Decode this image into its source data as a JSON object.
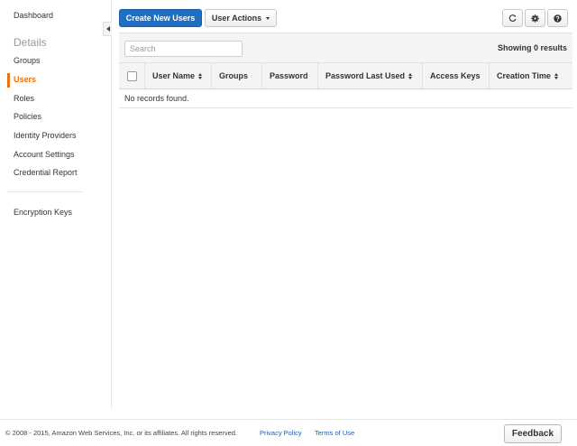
{
  "sidebar": {
    "dashboard": "Dashboard",
    "section_heading": "Details",
    "items": [
      {
        "label": "Groups"
      },
      {
        "label": "Users"
      },
      {
        "label": "Roles"
      },
      {
        "label": "Policies"
      },
      {
        "label": "Identity Providers"
      },
      {
        "label": "Account Settings"
      },
      {
        "label": "Credential Report"
      }
    ],
    "active_item": "Users",
    "encryption": "Encryption Keys"
  },
  "toolbar": {
    "create_label": "Create New Users",
    "actions_label": "User Actions",
    "icons": [
      "refresh-icon",
      "gear-icon",
      "help-icon"
    ]
  },
  "table": {
    "search_placeholder": "Search",
    "showing": "Showing 0 results",
    "columns": [
      {
        "label": "User Name",
        "sortable": true
      },
      {
        "label": "Groups",
        "sortable": false
      },
      {
        "label": "Password",
        "sortable": false
      },
      {
        "label": "Password Last Used",
        "sortable": true
      },
      {
        "label": "Access Keys",
        "sortable": false
      },
      {
        "label": "Creation Time",
        "sortable": true
      }
    ],
    "empty_text": "No records found."
  },
  "footer": {
    "copyright": "© 2008 - 2015, Amazon Web Services, Inc. or its affiliates. All rights reserved.",
    "privacy": "Privacy Policy",
    "terms": "Terms of Use",
    "feedback": "Feedback"
  },
  "colors": {
    "primary": "#1f6fc5",
    "active": "#ec7211",
    "link": "#1a5fb4"
  }
}
